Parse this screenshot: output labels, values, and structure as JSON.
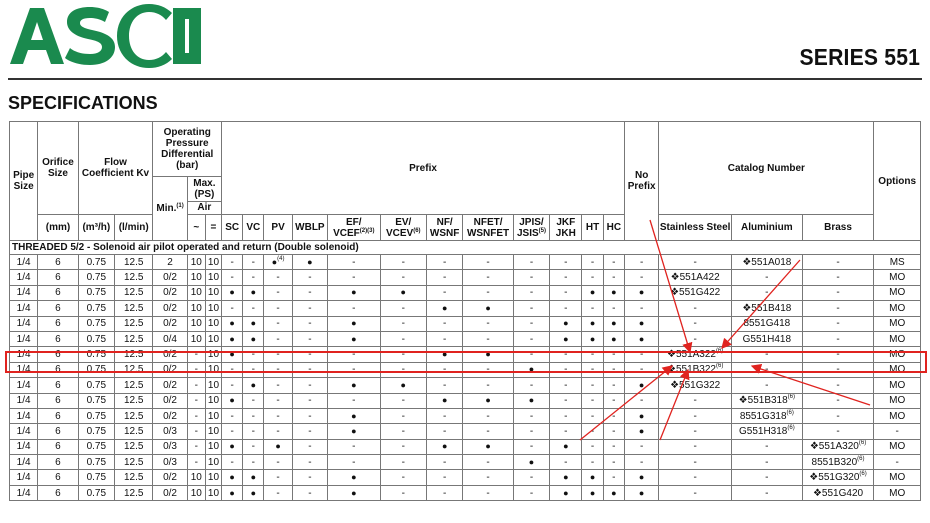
{
  "brand": {
    "logo_text": "ASCO",
    "tm": "™"
  },
  "series_title": "SERIES 551",
  "section_title": "SPECIFICATIONS",
  "headers": {
    "pipe_size": "Pipe Size",
    "orifice_size": "Orifice Size",
    "flow_coefficient": "Flow Coefficient Kv",
    "opd": "Operating Pressure Differential (bar)",
    "min": "Min.",
    "min_sup": "(1)",
    "max_ps": "Max. (PS)",
    "air": "Air",
    "prefix": "Prefix",
    "no_prefix": "No Prefix",
    "catalog_number": "Catalog Number",
    "options": "Options",
    "unit_mm": "(mm)",
    "unit_m3h": "(m³/h)",
    "unit_lmin": "(l/min)",
    "sym_tilde": "~",
    "sym_eq": "=",
    "prefix_cols": [
      {
        "label": "SC",
        "sup": ""
      },
      {
        "label": "VC",
        "sup": ""
      },
      {
        "label": "PV",
        "sup": ""
      },
      {
        "label": "WBLP",
        "sup": ""
      },
      {
        "label": "EF/ VCEF",
        "sup": "(2)(3)"
      },
      {
        "label": "EV/ VCEV",
        "sup": "(6)"
      },
      {
        "label": "NF/ WSNF",
        "sup": ""
      },
      {
        "label": "NFET/ WSNFET",
        "sup": ""
      },
      {
        "label": "JPIS/ JSIS",
        "sup": "(5)"
      },
      {
        "label": "JKF JKH",
        "sup": ""
      },
      {
        "label": "HT",
        "sup": ""
      },
      {
        "label": "HC",
        "sup": ""
      }
    ],
    "stainless": "Stainless Steel",
    "aluminium": "Aluminium",
    "brass": "Brass"
  },
  "section_row": "THREADED 5/2 - Solenoid air pilot operated and return (Double solenoid)",
  "rows": [
    [
      "1/4",
      "6",
      "0.75",
      "12.5",
      "2",
      "10",
      "10",
      "-",
      "-",
      "●",
      "●",
      "-",
      "-",
      "-",
      "-",
      "-",
      "-",
      "-",
      "-",
      "-",
      "-",
      "❖551A018",
      "-",
      "MS"
    ],
    [
      "1/4",
      "6",
      "0.75",
      "12.5",
      "0/2",
      "10",
      "10",
      "-",
      "-",
      "-",
      "-",
      "-",
      "-",
      "-",
      "-",
      "-",
      "-",
      "-",
      "-",
      "-",
      "❖551A422",
      "-",
      "-",
      "MO"
    ],
    [
      "1/4",
      "6",
      "0.75",
      "12.5",
      "0/2",
      "10",
      "10",
      "●",
      "●",
      "-",
      "-",
      "●",
      "●",
      "-",
      "-",
      "-",
      "-",
      "●",
      "●",
      "●",
      "❖551G422",
      "-",
      "-",
      "MO"
    ],
    [
      "1/4",
      "6",
      "0.75",
      "12.5",
      "0/2",
      "10",
      "10",
      "-",
      "-",
      "-",
      "-",
      "-",
      "-",
      "●",
      "●",
      "-",
      "-",
      "-",
      "-",
      "-",
      "-",
      "❖551B418",
      "-",
      "MO"
    ],
    [
      "1/4",
      "6",
      "0.75",
      "12.5",
      "0/2",
      "10",
      "10",
      "●",
      "●",
      "-",
      "-",
      "●",
      "-",
      "-",
      "-",
      "-",
      "●",
      "●",
      "●",
      "●",
      "-",
      "8551G418",
      "-",
      "MO"
    ],
    [
      "1/4",
      "6",
      "0.75",
      "12.5",
      "0/4",
      "10",
      "10",
      "●",
      "●",
      "-",
      "-",
      "●",
      "-",
      "-",
      "-",
      "-",
      "●",
      "●",
      "●",
      "●",
      "-",
      "G551H418",
      "-",
      "MO"
    ],
    [
      "1/4",
      "6",
      "0.75",
      "12.5",
      "0/2",
      "-",
      "10",
      "●",
      "-",
      "-",
      "-",
      "-",
      "-",
      "●",
      "●",
      "-",
      "-",
      "-",
      "-",
      "-",
      "❖551A322",
      "-",
      "-",
      "MO"
    ],
    [
      "1/4",
      "6",
      "0.75",
      "12.5",
      "0/2",
      "-",
      "10",
      "-",
      "-",
      "-",
      "-",
      "-",
      "-",
      "-",
      "-",
      "●",
      "-",
      "-",
      "-",
      "-",
      "❖551B322",
      "-",
      "-",
      "MO"
    ],
    [
      "1/4",
      "6",
      "0.75",
      "12.5",
      "0/2",
      "-",
      "10",
      "-",
      "●",
      "-",
      "-",
      "●",
      "●",
      "-",
      "-",
      "-",
      "-",
      "-",
      "-",
      "●",
      "❖551G322",
      "-",
      "-",
      "MO"
    ],
    [
      "1/4",
      "6",
      "0.75",
      "12.5",
      "0/2",
      "-",
      "10",
      "●",
      "-",
      "-",
      "-",
      "-",
      "-",
      "●",
      "●",
      "●",
      "-",
      "-",
      "-",
      "-",
      "-",
      "❖551B318",
      "-",
      "MO"
    ],
    [
      "1/4",
      "6",
      "0.75",
      "12.5",
      "0/2",
      "-",
      "10",
      "-",
      "-",
      "-",
      "-",
      "●",
      "-",
      "-",
      "-",
      "-",
      "-",
      "-",
      "-",
      "●",
      "-",
      "8551G318",
      "-",
      "MO"
    ],
    [
      "1/4",
      "6",
      "0.75",
      "12.5",
      "0/3",
      "-",
      "10",
      "-",
      "-",
      "-",
      "-",
      "●",
      "-",
      "-",
      "-",
      "-",
      "-",
      "-",
      "-",
      "●",
      "-",
      "G551H318",
      "-",
      "-"
    ],
    [
      "1/4",
      "6",
      "0.75",
      "12.5",
      "0/3",
      "-",
      "10",
      "●",
      "-",
      "●",
      "-",
      "-",
      "-",
      "●",
      "●",
      "-",
      "●",
      "-",
      "-",
      "-",
      "-",
      "-",
      "❖551A320",
      "MO"
    ],
    [
      "1/4",
      "6",
      "0.75",
      "12.5",
      "0/3",
      "-",
      "10",
      "-",
      "-",
      "-",
      "-",
      "-",
      "-",
      "-",
      "-",
      "●",
      "-",
      "-",
      "-",
      "-",
      "-",
      "-",
      "8551B320",
      "-"
    ],
    [
      "1/4",
      "6",
      "0.75",
      "12.5",
      "0/2",
      "10",
      "10",
      "●",
      "●",
      "-",
      "-",
      "●",
      "-",
      "-",
      "-",
      "-",
      "●",
      "●",
      "-",
      "●",
      "-",
      "-",
      "❖551G320",
      "MO"
    ],
    [
      "1/4",
      "6",
      "0.75",
      "12.5",
      "0/2",
      "10",
      "10",
      "●",
      "●",
      "-",
      "-",
      "●",
      "-",
      "-",
      "-",
      "-",
      "●",
      "●",
      "●",
      "●",
      "-",
      "-",
      "❖551G420",
      "MO"
    ]
  ],
  "superscripts": {
    "0-9": "(4)",
    "6-20": "(6)",
    "7-20": "(6)",
    "9-21": "(6)",
    "10-21": "(6)",
    "11-21": "(6)",
    "12-22": "(6)",
    "13-22": "(6)",
    "14-22": "(6)"
  },
  "colors": {
    "logo_green": "#1a8a4e",
    "highlight_red": "#e0231f"
  }
}
